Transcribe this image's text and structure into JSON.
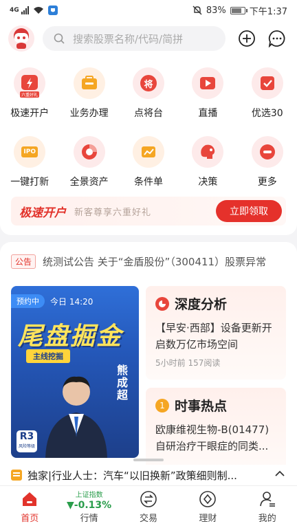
{
  "status_bar": {
    "network": "4G",
    "battery": "83%",
    "time": "下午1:37"
  },
  "header": {
    "search_placeholder": "搜索股票名称/代码/简拼"
  },
  "grid": [
    {
      "label": "极速开户",
      "badge": "六重好礼",
      "icon": "lightning-icon"
    },
    {
      "label": "业务办理",
      "icon": "briefcase-icon"
    },
    {
      "label": "点将台",
      "glyph": "将",
      "icon": "general-badge-icon"
    },
    {
      "label": "直播",
      "icon": "play-icon"
    },
    {
      "label": "优选30",
      "icon": "checklist-icon"
    },
    {
      "label": "一键打新",
      "glyph": "IPO",
      "icon": "ipo-icon"
    },
    {
      "label": "全景资产",
      "icon": "pie-chart-icon"
    },
    {
      "label": "条件单",
      "icon": "trend-icon"
    },
    {
      "label": "决策",
      "icon": "brain-icon"
    },
    {
      "label": "更多",
      "icon": "more-icon"
    }
  ],
  "banner": {
    "title": "极速开户",
    "subtitle": "新客尊享六重好礼",
    "button": "立即领取"
  },
  "notice": {
    "tag": "公告",
    "text": "统测试公告   关于“金盾股份”（300411）股票异常"
  },
  "poster": {
    "live_tag": "预约中",
    "time": "今日 14:20",
    "title": "尾盘掘金",
    "subtitle": "主线挖掘",
    "name": "熊成超",
    "risk_level": "R3",
    "risk_label": "风险等级"
  },
  "cards": [
    {
      "title": "深度分析",
      "body": "【早安·西部】设备更新开启数万亿市场空间",
      "meta": "5小时前  157阅读",
      "accent": "#e8463c"
    },
    {
      "title": "时事热点",
      "badge": "1",
      "body": "欧康维视生物-B(01477)自研治疗干眼症的同类...",
      "accent": "#f5a623"
    }
  ],
  "news": {
    "text": "独家|行业人士：汽车“以旧换新”政策细则制..."
  },
  "tabbar": {
    "market_index_name": "上证指数",
    "market_index_value": "▼-0.13%",
    "tabs": [
      {
        "label": "首页"
      },
      {
        "label": "行情"
      },
      {
        "label": "交易"
      },
      {
        "label": "理财"
      },
      {
        "label": "我的"
      }
    ]
  },
  "colors": {
    "brand": "#e2332b",
    "down": "#2a9d4b"
  }
}
